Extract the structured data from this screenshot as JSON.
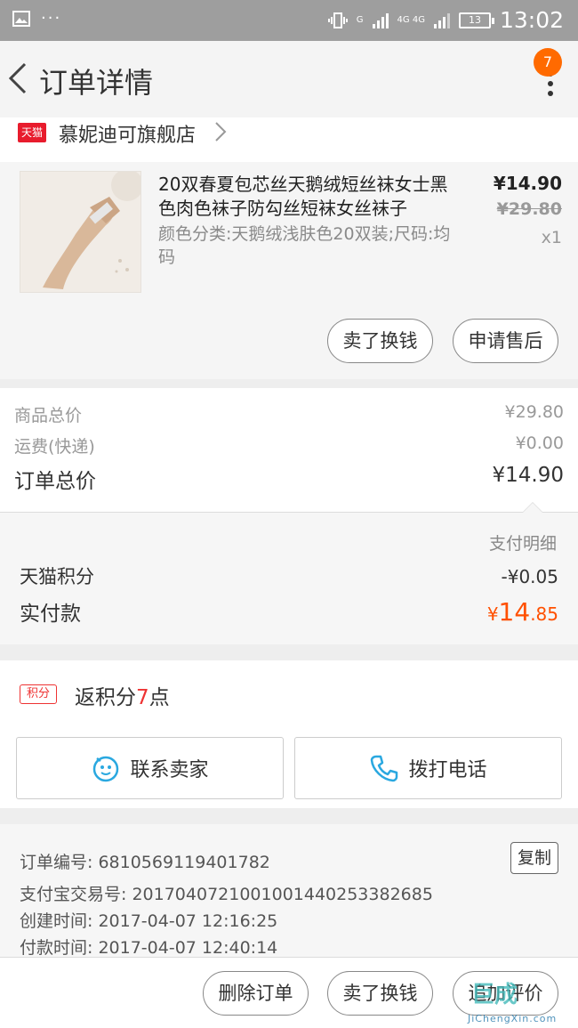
{
  "status_bar": {
    "time": "13:02",
    "battery": "13",
    "net1": "G",
    "net2": "4G 4G"
  },
  "header": {
    "title": "订单详情",
    "badge_count": "7"
  },
  "store": {
    "logo_text": "天猫",
    "name": "慕妮迪可旗舰店"
  },
  "product": {
    "title": "20双春夏包芯丝天鹅绒短丝袜女士黑色肉色袜子防勾丝短袜女丝袜子",
    "spec": "颜色分类:天鹅绒浅肤色20双装;尺码:均码",
    "price": "¥14.90",
    "original_price": "¥29.80",
    "quantity": "x1",
    "buttons": {
      "sell": "卖了换钱",
      "after_sale": "申请售后"
    }
  },
  "totals": {
    "goods_label": "商品总价",
    "goods_value": "¥29.80",
    "shipping_label": "运费(快递)",
    "shipping_value": "¥0.00",
    "order_label": "订单总价",
    "order_value": "¥14.90"
  },
  "payment": {
    "detail_label": "支付明细",
    "points_label": "天猫积分",
    "points_value": "-¥0.05",
    "paid_label": "实付款",
    "paid_currency": "¥",
    "paid_int": "14",
    "paid_dec": ".85"
  },
  "points_return": {
    "badge": "积分",
    "prefix": "返积分",
    "number": "7",
    "suffix": "点"
  },
  "contact": {
    "seller": "联系卖家",
    "phone": "拨打电话"
  },
  "order_info": {
    "order_no_label": "订单编号:",
    "order_no": "6810569119401782",
    "copy": "复制",
    "alipay_label": "支付宝交易号:",
    "alipay_no": "2017040721001001440253382685",
    "created_label": "创建时间:",
    "created": "2017-04-07 12:16:25",
    "paid_label": "付款时间:",
    "paid": "2017-04-07 12:40:14"
  },
  "bottom": {
    "delete": "删除订单",
    "sell": "卖了换钱",
    "review": "追加评价"
  },
  "watermark": {
    "logo": "巨成",
    "url": "JiChengXin.com"
  },
  "colors": {
    "accent": "#ff5000",
    "badge": "#ff6a00",
    "tmall_red": "#e81c2d",
    "points_red": "#e33333",
    "contact_icon": "#2aa8e0"
  }
}
